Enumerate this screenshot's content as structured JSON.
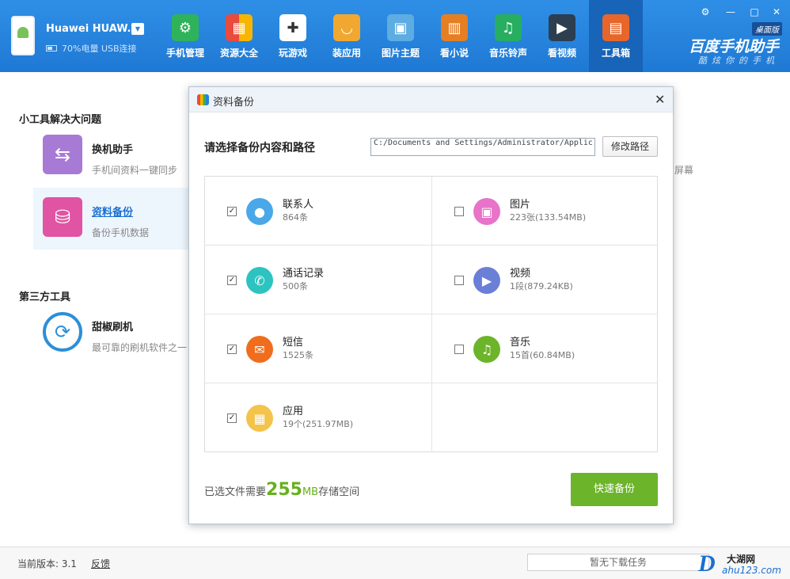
{
  "header": {
    "device_name": "Huawei HUAW...",
    "device_status": "70%电量 USB连接",
    "brand": "百度手机助手",
    "brand_sub": "酷炫你的手机",
    "edition": "桌面版",
    "nav": [
      {
        "label": "手机管理",
        "icon": "phone-manage-icon",
        "color": "#2fb35a"
      },
      {
        "label": "资源大全",
        "icon": "resources-icon",
        "color": "#f39c12"
      },
      {
        "label": "玩游戏",
        "icon": "gamepad-icon",
        "color": "#ffffff"
      },
      {
        "label": "装应用",
        "icon": "shopping-bag-icon",
        "color": "#f0a830"
      },
      {
        "label": "图片主题",
        "icon": "picture-icon",
        "color": "#5dade2"
      },
      {
        "label": "看小说",
        "icon": "book-icon",
        "color": "#e67e22"
      },
      {
        "label": "音乐铃声",
        "icon": "music-icon",
        "color": "#27ae60"
      },
      {
        "label": "看视频",
        "icon": "video-icon",
        "color": "#2c3e50"
      },
      {
        "label": "工具箱",
        "icon": "toolbox-icon",
        "color": "#e8662a"
      }
    ],
    "active_nav": "工具箱"
  },
  "left": {
    "section1": "小工具解决大问题",
    "tool1_title": "换机助手",
    "tool1_desc": "手机间资料一键同步",
    "tool2_title": "资料备份",
    "tool2_desc": "备份手机数据",
    "section2": "第三方工具",
    "tool3_title": "甜椒刷机",
    "tool3_desc": "最可靠的刷机软件之一",
    "right_hint": "屏幕"
  },
  "dialog": {
    "title": "资料备份",
    "prompt": "请选择备份内容和路径",
    "path": "C:/Documents and Settings/Administrator/Applic",
    "change_path": "修改路径",
    "items": [
      {
        "name": "联系人",
        "count": "864条",
        "checked": true,
        "icon": "contact-icon",
        "color": "#4aa8e8"
      },
      {
        "name": "图片",
        "count": "223张(133.54MB)",
        "checked": false,
        "icon": "picture-icon",
        "color": "#e873c9"
      },
      {
        "name": "通话记录",
        "count": "500条",
        "checked": true,
        "icon": "phone-icon",
        "color": "#2cc3c0"
      },
      {
        "name": "视频",
        "count": "1段(879.24KB)",
        "checked": false,
        "icon": "video-icon",
        "color": "#6a7fd6"
      },
      {
        "name": "短信",
        "count": "1525条",
        "checked": true,
        "icon": "mail-icon",
        "color": "#ef6d1c"
      },
      {
        "name": "音乐",
        "count": "15首(60.84MB)",
        "checked": false,
        "icon": "music-icon",
        "color": "#6cb42a"
      },
      {
        "name": "应用",
        "count": "19个(251.97MB)",
        "checked": true,
        "icon": "apps-icon",
        "color": "#f3c34a"
      }
    ],
    "summary_prefix": "已选文件需要",
    "summary_value": "255",
    "summary_unit": "MB",
    "summary_suffix": "存储空间",
    "backup_button": "快速备份"
  },
  "footer": {
    "version": "当前版本: 3.1",
    "feedback": "反馈",
    "task": "暂无下载任务",
    "watermark_letter": "D",
    "watermark_cn": "大湖网",
    "watermark_url": "ahu123.com"
  }
}
